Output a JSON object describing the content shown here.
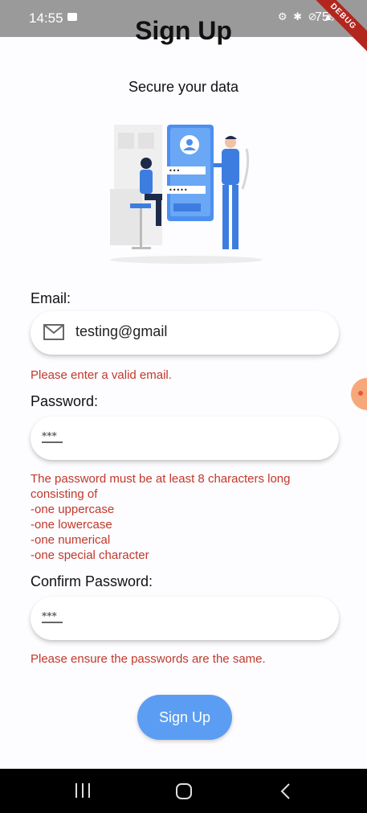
{
  "status_bar": {
    "time": "14:55",
    "icons_text": "⚙ ✱ 🔇 Vo LTE ",
    "battery": "75%",
    "debug_banner": "DEBUG"
  },
  "page": {
    "title": "Sign Up",
    "subtitle": "Secure your data"
  },
  "email": {
    "label": "Email:",
    "value": "testing@gmail",
    "error": "Please enter a valid email."
  },
  "password": {
    "label": "Password:",
    "placeholder_icon": "password-icon",
    "error_lines": [
      "The password must be at least 8 characters long",
      "consisting of",
      "-one uppercase",
      "-one lowercase",
      "-one numerical",
      "-one special character"
    ]
  },
  "confirm_password": {
    "label": "Confirm Password:",
    "error": "Please ensure the passwords are the same."
  },
  "button": {
    "label": "Sign Up"
  },
  "colors": {
    "error": "#c0392b",
    "accent": "#5b9df2"
  }
}
